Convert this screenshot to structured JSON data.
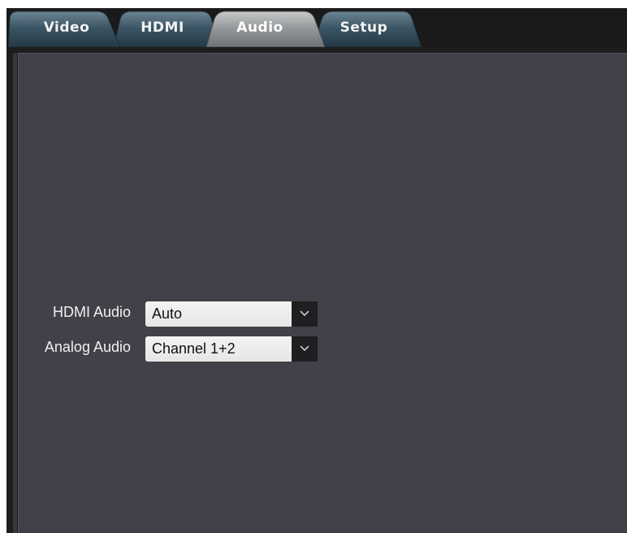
{
  "tabs": [
    {
      "label": "Video",
      "active": false
    },
    {
      "label": "HDMI",
      "active": false
    },
    {
      "label": "Audio",
      "active": true
    },
    {
      "label": "Setup",
      "active": false
    }
  ],
  "settings": {
    "hdmi_audio": {
      "label": "HDMI Audio",
      "value": "Auto"
    },
    "analog_audio": {
      "label": "Analog Audio",
      "value": "Channel 1+2"
    }
  },
  "colors": {
    "panel_background": "#424149",
    "tab_inactive": "#2e4a5a",
    "tab_active": "#8f9294",
    "dropdown_arrow_bg": "#1f1f21"
  },
  "icons": {
    "dropdown_arrow": "chevron-down-icon"
  }
}
